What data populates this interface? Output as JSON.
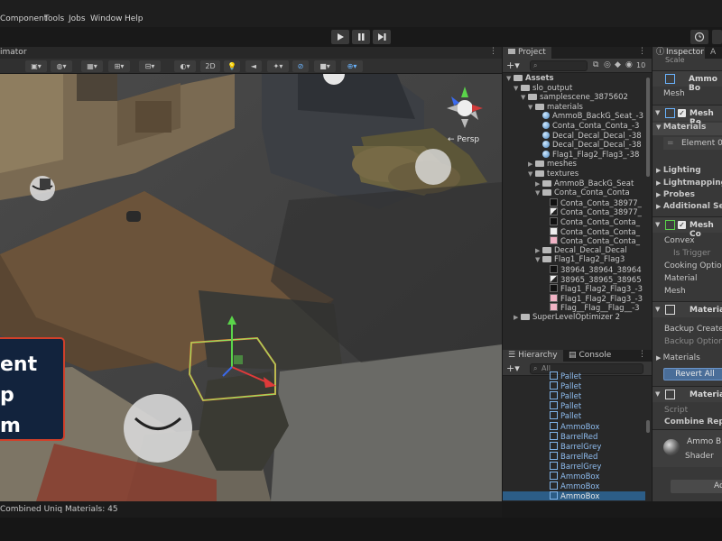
{
  "menu": {
    "items": [
      "Component",
      "Tools",
      "Jobs",
      "Window",
      "Help"
    ]
  },
  "toolbar": {
    "play_icon": "play-icon",
    "pause_icon": "pause-icon",
    "step_icon": "step-icon",
    "history_icon": "history-icon"
  },
  "scene": {
    "tab_title": "imator",
    "toolbar_2d_label": "2D",
    "persp_label": "← Persp",
    "overlay_lines": [
      "ent",
      "p",
      "m"
    ],
    "status_text": "Combined Uniq Materials: 45"
  },
  "project": {
    "tab_label": "Project",
    "slider_value": "10",
    "tree": [
      {
        "label": "Assets",
        "depth": 0,
        "icon": "folder",
        "expanded": true,
        "bold": true
      },
      {
        "label": "slo_output",
        "depth": 1,
        "icon": "folder",
        "expanded": true
      },
      {
        "label": "samplescene_3875602",
        "depth": 2,
        "icon": "folder",
        "expanded": true
      },
      {
        "label": "materials",
        "depth": 3,
        "icon": "folder",
        "expanded": true
      },
      {
        "label": "AmmoB_BackG_Seat_-3",
        "depth": 4,
        "icon": "material"
      },
      {
        "label": "Conta_Conta_Conta_-3",
        "depth": 4,
        "icon": "material"
      },
      {
        "label": "Decal_Decal_Decal_-38",
        "depth": 4,
        "icon": "material"
      },
      {
        "label": "Decal_Decal_Decal_-38",
        "depth": 4,
        "icon": "material"
      },
      {
        "label": "Flag1_Flag2_Flag3_-38",
        "depth": 4,
        "icon": "material"
      },
      {
        "label": "meshes",
        "depth": 3,
        "icon": "folder",
        "expanded": false
      },
      {
        "label": "textures",
        "depth": 3,
        "icon": "folder",
        "expanded": true
      },
      {
        "label": "AmmoB_BackG_Seat",
        "depth": 4,
        "icon": "folder",
        "expanded": false
      },
      {
        "label": "Conta_Conta_Conta",
        "depth": 4,
        "icon": "folder",
        "expanded": true
      },
      {
        "label": "Conta_Conta_38977_",
        "depth": 5,
        "icon": "tex-dark"
      },
      {
        "label": "Conta_Conta_38977_",
        "depth": 5,
        "icon": "tex-mix"
      },
      {
        "label": "Conta_Conta_Conta_",
        "depth": 5,
        "icon": "tex-dark"
      },
      {
        "label": "Conta_Conta_Conta_",
        "depth": 5,
        "icon": "tex-white"
      },
      {
        "label": "Conta_Conta_Conta_",
        "depth": 5,
        "icon": "tex-pink"
      },
      {
        "label": "Decal_Decal_Decal",
        "depth": 4,
        "icon": "folder",
        "expanded": false
      },
      {
        "label": "Flag1_Flag2_Flag3",
        "depth": 4,
        "icon": "folder",
        "expanded": true
      },
      {
        "label": "38964_38964_38964",
        "depth": 5,
        "icon": "tex-dark"
      },
      {
        "label": "38965_38965_38965",
        "depth": 5,
        "icon": "tex-mix"
      },
      {
        "label": "Flag1_Flag2_Flag3_-3",
        "depth": 5,
        "icon": "tex-dark"
      },
      {
        "label": "Flag1_Flag2_Flag3_-3",
        "depth": 5,
        "icon": "tex-pink"
      },
      {
        "label": "Flag__Flag__Flag__-3",
        "depth": 5,
        "icon": "tex-pink"
      },
      {
        "label": "SuperLevelOptimizer 2",
        "depth": 1,
        "icon": "folder",
        "expanded": false
      }
    ]
  },
  "hierarchy": {
    "tab_label": "Hierarchy",
    "console_tab_label": "Console",
    "search_placeholder": "All",
    "items": [
      "Pallet",
      "Pallet",
      "Pallet",
      "Pallet",
      "Pallet",
      "AmmoBox",
      "BarrelRed",
      "BarrelGrey",
      "BarrelRed",
      "BarrelGrey",
      "AmmoBox",
      "AmmoBox",
      "AmmoBox"
    ],
    "selected_index": 12
  },
  "inspector": {
    "tab_label": "Inspector",
    "scale_label": "Scale",
    "ammo_header": "Ammo Bo",
    "mesh_label": "Mesh",
    "mesh_renderer_title": "Mesh Re",
    "materials_label": "Materials",
    "element0_label": "Element 0",
    "lighting_label": "Lighting",
    "lightmapping_label": "Lightmapping",
    "probes_label": "Probes",
    "additional_label": "Additional Setti",
    "mesh_collider_title": "Mesh Co",
    "convex_label": "Convex",
    "is_trigger_label": "Is Trigger",
    "cooking_label": "Cooking Option",
    "material_label": "Material",
    "mesh2_label": "Mesh",
    "material_script_title": "Material",
    "backup_created_label": "Backup Created",
    "backup_option_label": "Backup Option",
    "materials2_label": "Materials",
    "revert_all_label": "Revert All",
    "material2_title": "Material",
    "script_label": "Script",
    "combine_label": "Combine Repor",
    "ammo_b_label": "Ammo B",
    "shader_label": "Shader",
    "add_label": "Ad"
  }
}
